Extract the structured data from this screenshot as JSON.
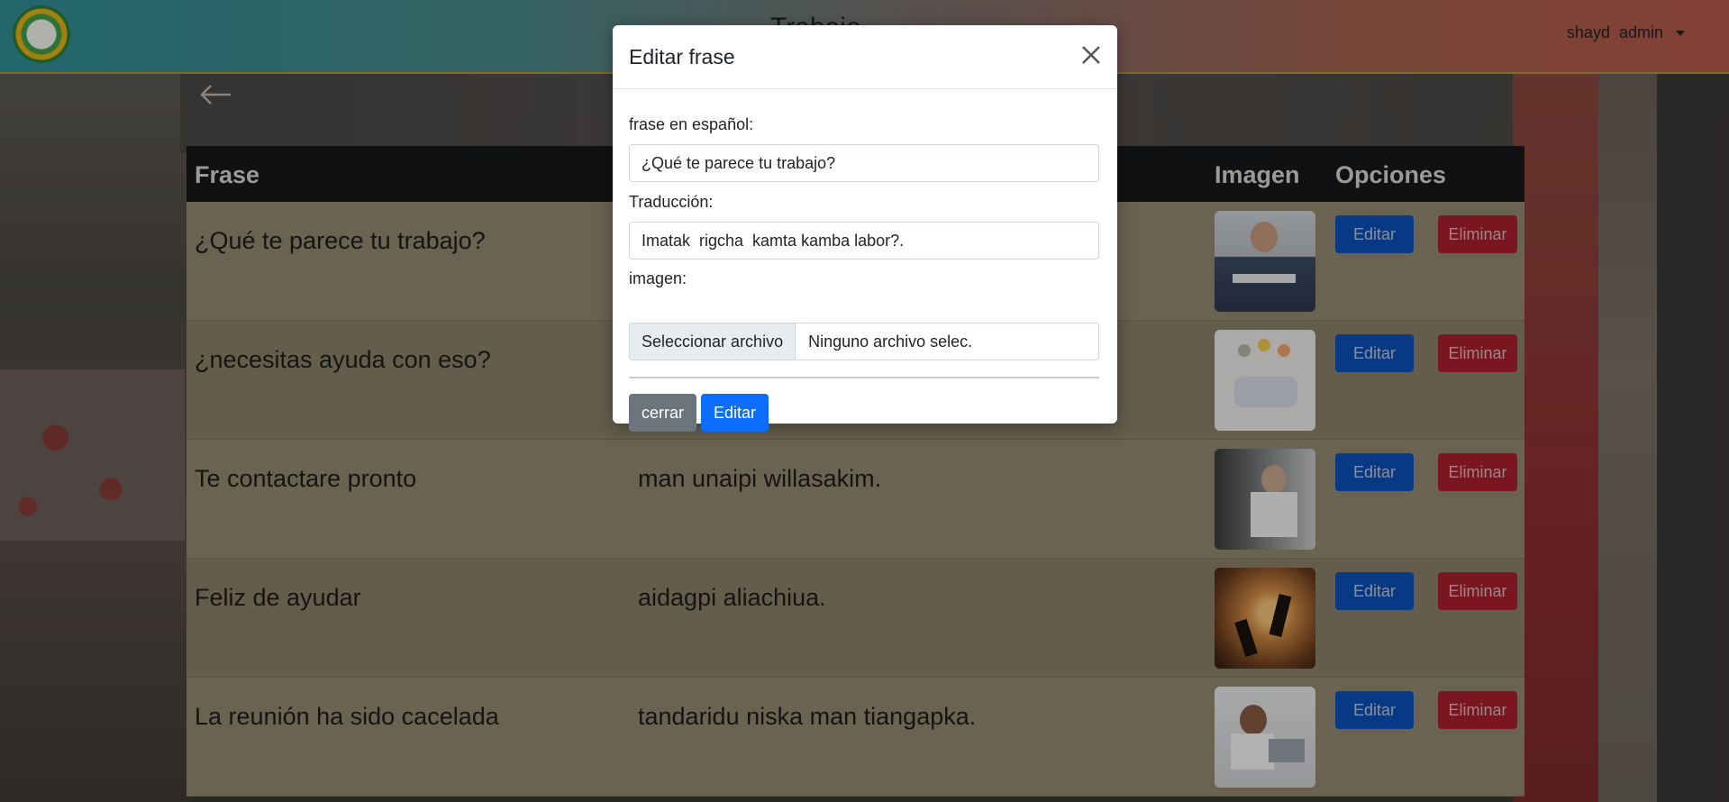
{
  "header": {
    "title": "Trabajo",
    "user_name": "shayd",
    "user_role": "admin"
  },
  "table": {
    "columns": [
      "Frase",
      "",
      "Imagen",
      "Opciones"
    ],
    "rows": [
      {
        "frase": "¿Qué te parece tu trabajo?",
        "traduccion": "",
        "image": "man-laptop-photo"
      },
      {
        "frase": "¿necesitas ayuda con eso?",
        "traduccion": "",
        "image": "team-meeting-illustration"
      },
      {
        "frase": "Te contactare pronto",
        "traduccion": "man unaipi willasakim.",
        "image": "woman-writing-photo"
      },
      {
        "frase": "Feliz de ayudar",
        "traduccion": "aidagpi aliachiua.",
        "image": "helping-hand-sunset-photo"
      },
      {
        "frase": "La reunión ha sido cacelada",
        "traduccion": "tandaridu niska man tiangapka.",
        "image": "woman-laptop-photo"
      }
    ],
    "edit_label": "Editar",
    "delete_label": "Eliminar"
  },
  "modal": {
    "title": "Editar frase",
    "label_spanish": "frase en español:",
    "value_spanish": "¿Qué te parece tu trabajo?",
    "label_translation": "Traducción:",
    "value_translation": "Imatak  rigcha  kamta kamba labor?.",
    "label_image": "imagen:",
    "file_button": "Seleccionar archivo",
    "file_status": "Ninguno archivo selec.",
    "close_button": "cerrar",
    "submit_button": "Editar"
  },
  "colors": {
    "primary": "#0d6efd",
    "danger": "#a81f2c",
    "secondary": "#6c757d",
    "table_header": "#15181b"
  }
}
